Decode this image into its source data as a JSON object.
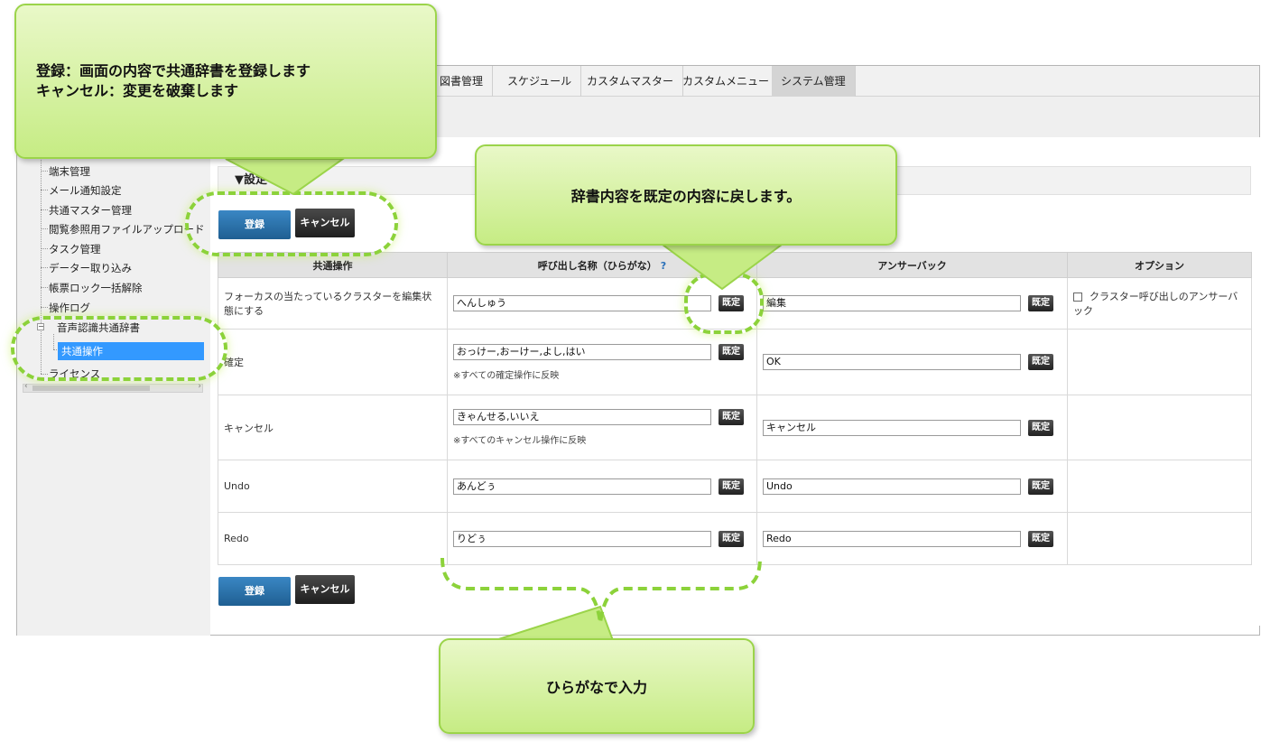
{
  "nav": {
    "tabs": [
      "図書管理",
      "スケジュール",
      "カスタムマスター",
      "カスタムメニュー",
      "システム管理"
    ],
    "active_tab": "システム管理"
  },
  "sidebar": {
    "items": [
      "端末管理",
      "メール通知設定",
      "共通マスター管理",
      "閲覧参照用ファイルアップロード",
      "タスク管理",
      "データー取り込み",
      "帳票ロック一括解除",
      "操作ログ",
      "音声認識共通辞書",
      "共通操作",
      "ライセンス"
    ],
    "selected": "共通操作"
  },
  "settings": {
    "heading": "▼設定",
    "register_label": "登録",
    "cancel_label": "キャンセル"
  },
  "table": {
    "headers": [
      "共通操作",
      "呼び出し名称（ひらがな）",
      "アンサーバック",
      "オプション"
    ],
    "help_mark": "?",
    "default_label": "既定",
    "rows": [
      {
        "operation": "フォーカスの当たっているクラスターを編集状態にする",
        "call_name": "へんしゅう",
        "note": "",
        "answer": "編集",
        "option": "クラスター呼び出しのアンサーバック"
      },
      {
        "operation": "確定",
        "call_name": "おっけー,おーけー,よし,はい",
        "note": "※すべての確定操作に反映",
        "answer": "OK",
        "option": ""
      },
      {
        "operation": "キャンセル",
        "call_name": "きゃんせる,いいえ",
        "note": "※すべてのキャンセル操作に反映",
        "answer": "キャンセル",
        "option": ""
      },
      {
        "operation": "Undo",
        "call_name": "あんどぅ",
        "note": "",
        "answer": "Undo",
        "option": ""
      },
      {
        "operation": "Redo",
        "call_name": "りどぅ",
        "note": "",
        "answer": "Redo",
        "option": ""
      }
    ]
  },
  "callouts": {
    "top_left_line1": "登録：画面の内容で共通辞書を登録します",
    "top_left_line2": "キャンセル：変更を破棄します",
    "default_note": "辞書内容を既定の内容に戻します。",
    "hiragana_note": "ひらがなで入力"
  },
  "colors": {
    "callout_green": "#c6ec84",
    "dash_green": "#8cd23a",
    "selected_blue": "#3399ff",
    "button_blue": "#1f5f92"
  }
}
